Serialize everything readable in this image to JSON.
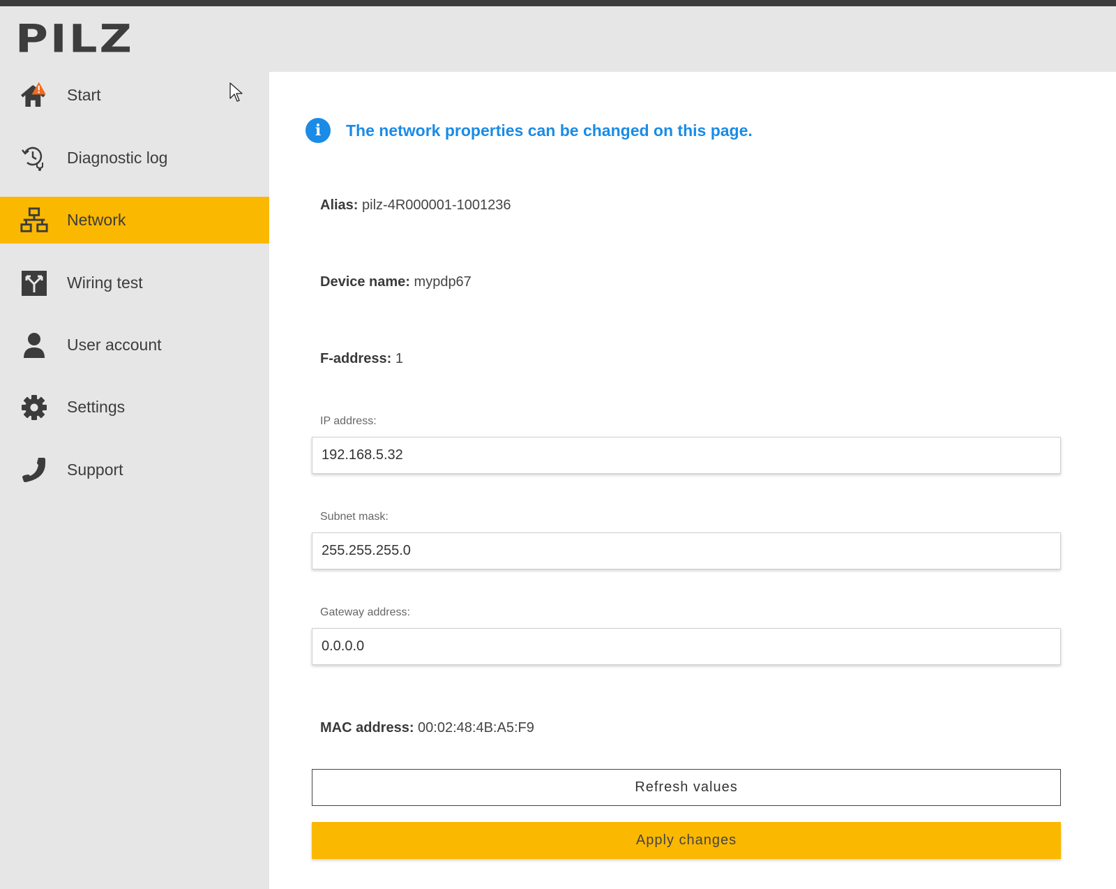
{
  "header": {
    "logo_text": "PILZ"
  },
  "sidebar": {
    "items": [
      {
        "label": "Start",
        "icon": "home-warning-icon"
      },
      {
        "label": "Diagnostic log",
        "icon": "diagnostic-log-icon"
      },
      {
        "label": "Network",
        "icon": "network-icon",
        "active": true
      },
      {
        "label": "Wiring test",
        "icon": "wiring-test-icon"
      },
      {
        "label": "User account",
        "icon": "user-icon"
      },
      {
        "label": "Settings",
        "icon": "gear-icon"
      },
      {
        "label": "Support",
        "icon": "phone-icon"
      }
    ]
  },
  "main": {
    "info_message": "The network properties can be changed on this page.",
    "alias": {
      "label": "Alias:",
      "value": "pilz-4R000001-1001236"
    },
    "device_name": {
      "label": "Device name:",
      "value": "mypdp67"
    },
    "f_address": {
      "label": "F-address:",
      "value": "1"
    },
    "ip_address": {
      "label": "IP address:",
      "value": "192.168.5.32"
    },
    "subnet_mask": {
      "label": "Subnet mask:",
      "value": "255.255.255.0"
    },
    "gateway_address": {
      "label": "Gateway address:",
      "value": "0.0.0.0"
    },
    "mac_address": {
      "label": "MAC address:",
      "value": "00:02:48:4B:A5:F9"
    },
    "refresh_label": "Refresh values",
    "apply_label": "Apply changes"
  },
  "colors": {
    "accent": "#fbb800",
    "info": "#1a8be6",
    "warning": "#f26b1d",
    "sidebar_bg": "#e6e6e6"
  }
}
